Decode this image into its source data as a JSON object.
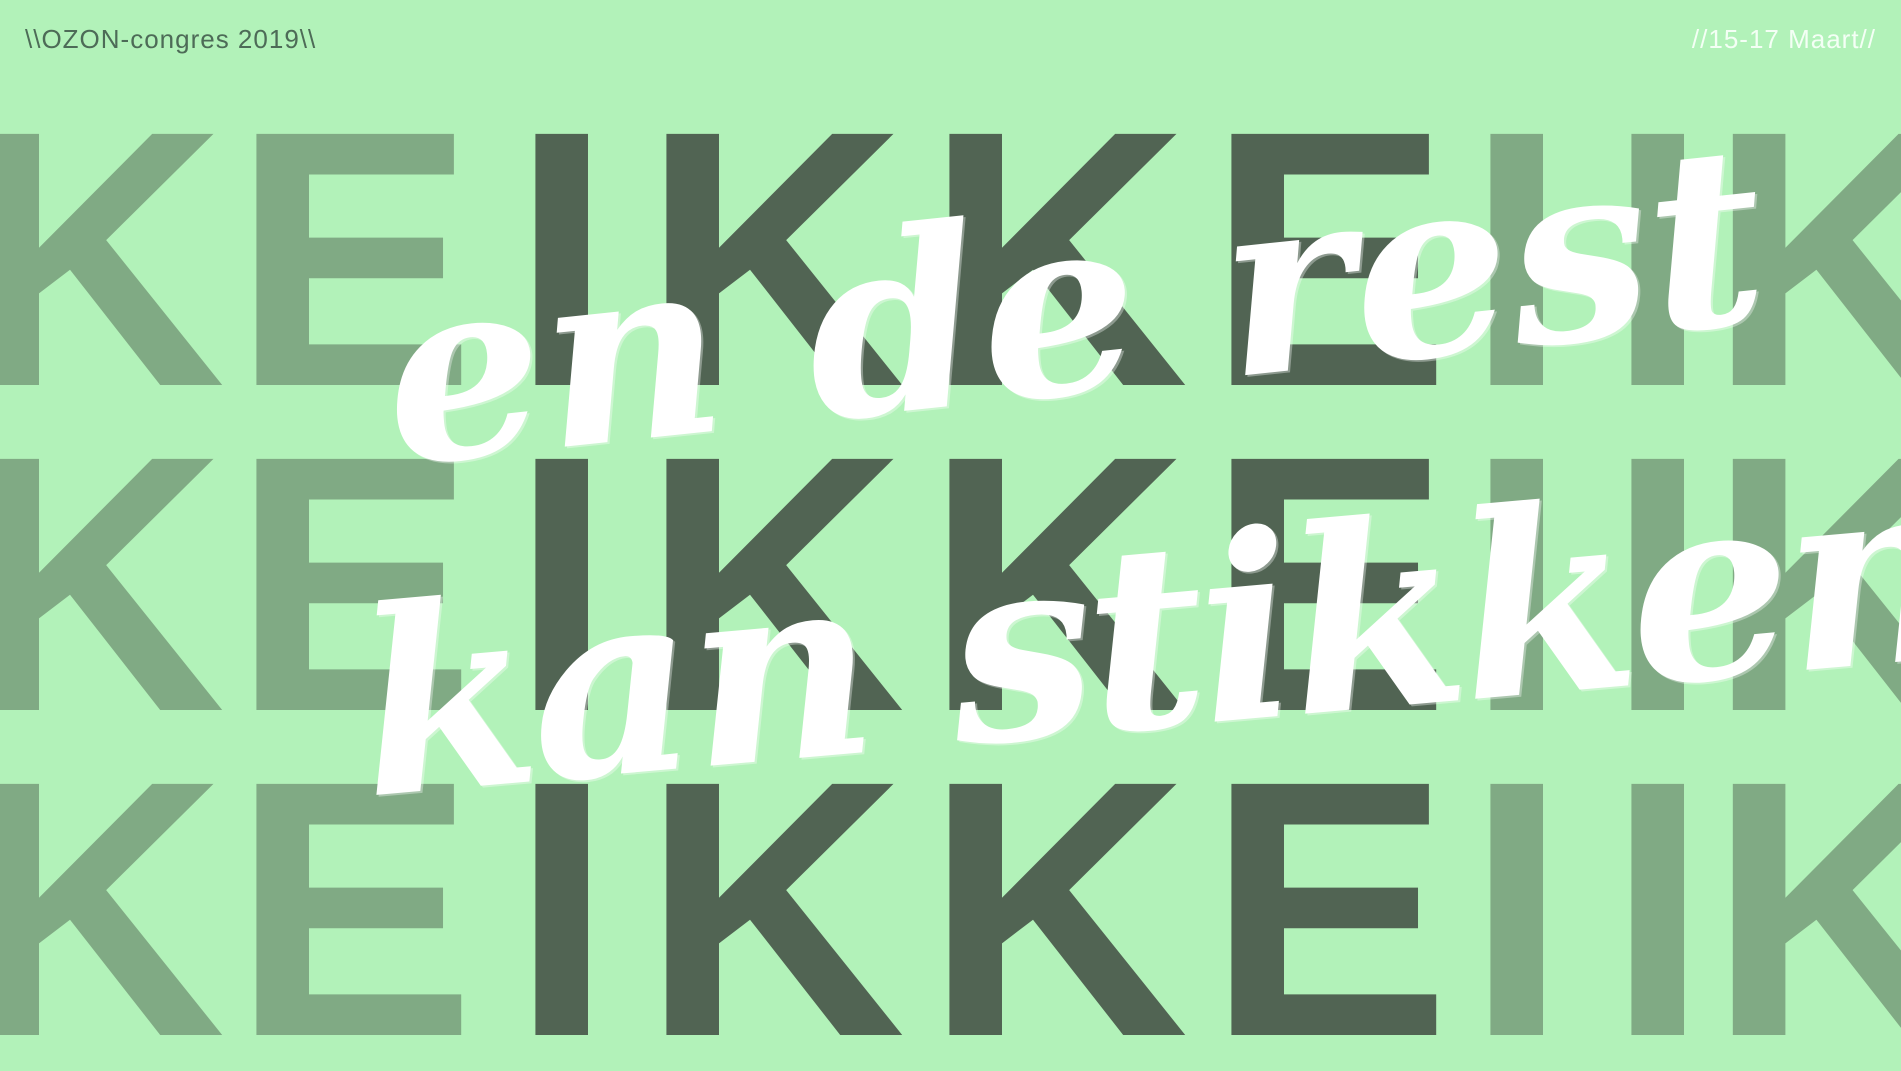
{
  "header": {
    "left_text": "\\\\OZON-congres 2019\\\\",
    "right_text": "//15-17 Maart//"
  },
  "rows": [
    [
      "KE",
      "E",
      "I",
      "K",
      "K",
      "E",
      "I",
      "IK"
    ],
    [
      "KE",
      "E",
      "I",
      "K",
      "K",
      "E",
      "I",
      "IK"
    ],
    [
      "KE",
      "E",
      "I",
      "K",
      "K",
      "E",
      "I",
      "IK"
    ]
  ],
  "headline": {
    "line1": "en de rest",
    "line2": "kan stikken"
  },
  "colors": {
    "background": "#b2f2b9",
    "letter_light": "#80aa84",
    "letter_dark": "#516453",
    "script": "#ffffff"
  }
}
